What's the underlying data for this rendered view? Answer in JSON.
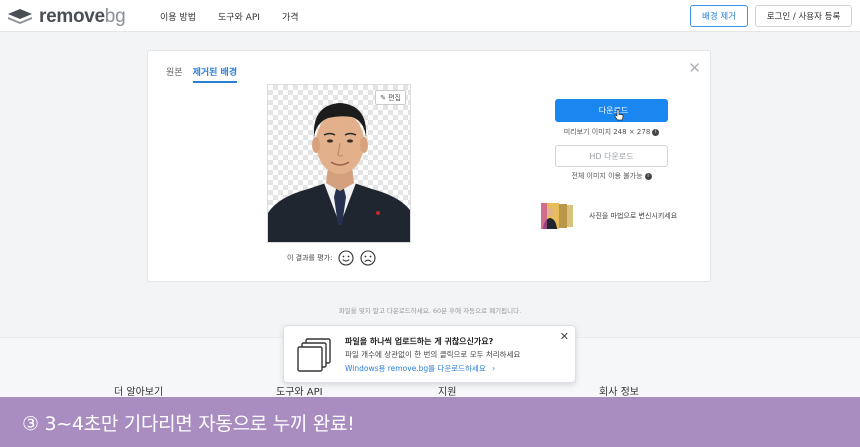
{
  "header": {
    "logo_text": "remove",
    "logo_suffix": "bg",
    "nav": [
      "이용 방법",
      "도구와 API",
      "가격"
    ],
    "remove_bg_button": "배경 제거",
    "login_button": "로그인 / 사용자 등록"
  },
  "card": {
    "tabs": [
      "원본",
      "제거된 배경"
    ],
    "active_tab": "제거된 배경",
    "edit_label": "편집",
    "rating_label": "이 결과를 평가:",
    "download_button": "다운로드",
    "download_info": "미리보기 이미지 248 × 278",
    "hd_button": "HD 다운로드",
    "hd_info": "전체 이미지 이용 불가능",
    "magic_text": "사진을 마법으로 변신시키세요"
  },
  "footnote": "파일을 잊지 말고 다운로드하세요. 60분 후에 자동으로 폐기됩니다.",
  "popup": {
    "title": "파일을 하나씩 업로드하는 게 귀찮으신가요?",
    "description": "파일 개수에 상관없이 한 번의 클릭으로 모두 처리하세요",
    "link": "Windows용 remove.bg를 다운로드하세요"
  },
  "footer": {
    "columns": [
      "더 알아보기",
      "도구와 API",
      "지원",
      "회사 정보"
    ]
  },
  "banner": {
    "text": "③ 3~4초만 기다리면 자동으로 누끼 완료!"
  },
  "colors": {
    "accent": "#1a86f0",
    "banner": "#a98dc1"
  }
}
